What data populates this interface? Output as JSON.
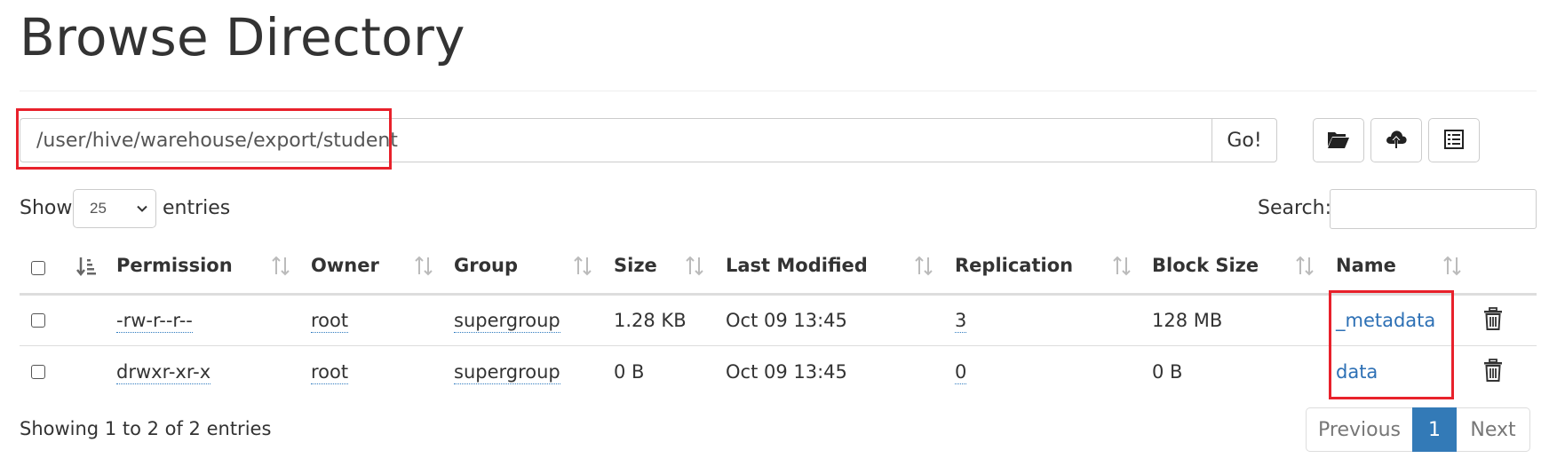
{
  "page": {
    "title": "Browse Directory"
  },
  "toolbar": {
    "path_value": "/user/hive/warehouse/export/student",
    "go_label": "Go!",
    "buttons": [
      "folder-open-icon",
      "cloud-upload-icon",
      "list-icon"
    ]
  },
  "table_controls": {
    "show_label": "Show",
    "entries_value": "25",
    "entries_label": "entries",
    "search_label": "Search:",
    "search_value": ""
  },
  "table": {
    "columns": [
      "Permission",
      "Owner",
      "Group",
      "Size",
      "Last Modified",
      "Replication",
      "Block Size",
      "Name"
    ],
    "rows": [
      {
        "permission": "-rw-r--r--",
        "owner": "root",
        "group": "supergroup",
        "size": "1.28 KB",
        "last_modified": "Oct 09 13:45",
        "replication": "3",
        "block_size": "128 MB",
        "name": "_metadata"
      },
      {
        "permission": "drwxr-xr-x",
        "owner": "root",
        "group": "supergroup",
        "size": "0 B",
        "last_modified": "Oct 09 13:45",
        "replication": "0",
        "block_size": "0 B",
        "name": "data"
      }
    ]
  },
  "footer": {
    "info": "Showing 1 to 2 of 2 entries",
    "pagination": {
      "previous": "Previous",
      "current": "1",
      "next": "Next"
    }
  },
  "colors": {
    "highlight": "#e8212b",
    "link": "#2d70b5",
    "active_page": "#337ab7"
  }
}
